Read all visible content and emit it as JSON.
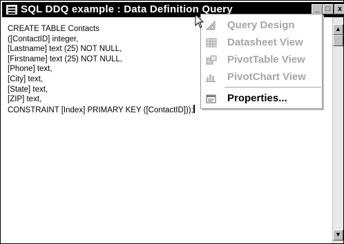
{
  "window": {
    "title": "SQL DDQ example : Data Definition Query"
  },
  "title_buttons": {
    "minimize": "_",
    "maximize": "□",
    "close": "x"
  },
  "editor": {
    "lines": [
      "CREATE TABLE Contacts",
      "([ContactID] integer,",
      "[Lastname] text (25) NOT NULL,",
      "[Firstname] text (25) NOT NULL,",
      "[Phone] text,",
      "[City] text,",
      "[State] text,",
      "[ZIP] text,",
      "CONSTRAINT [Index] PRIMARY KEY ([ContactID]));"
    ]
  },
  "scrollbar": {
    "up_arrow": "▲",
    "down_arrow": "▼"
  },
  "context_menu": {
    "items": [
      {
        "label": "Query Design",
        "icon": "triangle-ruler-icon",
        "enabled": false
      },
      {
        "label": "Datasheet View",
        "icon": "datasheet-grid-icon",
        "enabled": false
      },
      {
        "label": "PivotTable View",
        "icon": "pivottable-icon",
        "enabled": false
      },
      {
        "label": "PivotChart View",
        "icon": "pivotchart-icon",
        "enabled": false
      },
      {
        "label": "Properties...",
        "icon": "properties-icon",
        "enabled": true
      }
    ]
  },
  "colors": {
    "titlebar": "#000000",
    "disabled_text": "#a6a6a6",
    "menu_background": "#ffffff"
  }
}
